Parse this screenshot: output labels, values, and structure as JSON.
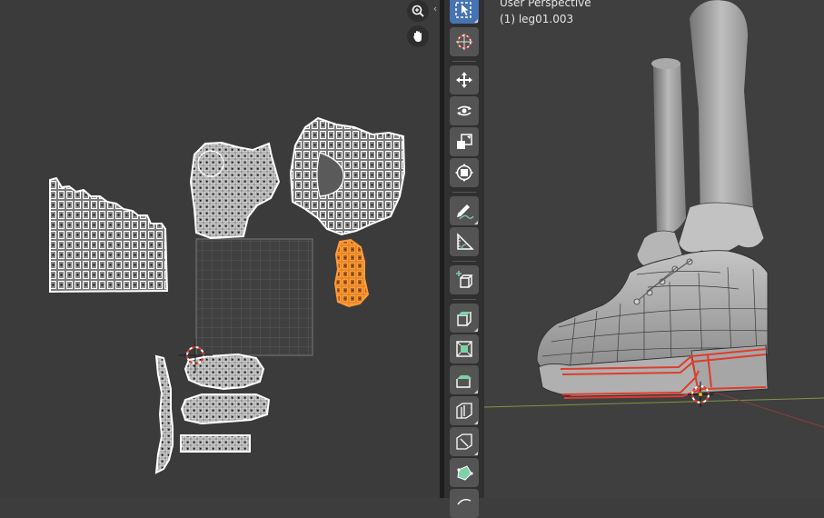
{
  "viewport": {
    "perspective_label": "User Perspective",
    "object_label": "(1) leg01.003"
  },
  "uv_editor": {
    "nav_icons": [
      "zoom-icon",
      "hand-pan-icon"
    ],
    "collapse_glyph": "‹"
  },
  "toolbar": {
    "tools": [
      "select-box",
      "cursor",
      "move",
      "rotate",
      "scale",
      "transform",
      "annotate",
      "measure",
      "add-cube",
      "extrude-region",
      "inset-faces",
      "bevel",
      "loop-cut",
      "knife",
      "poly-build"
    ]
  },
  "colors": {
    "accent_active": "#4772b3",
    "selection_orange": "#f0851e",
    "edge_highlight": "#e03c2c"
  }
}
